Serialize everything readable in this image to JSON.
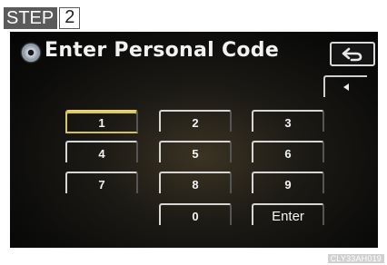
{
  "step": {
    "word": "STEP",
    "number": "2"
  },
  "screen": {
    "title": "Enter Personal Code",
    "back_icon": "return-arrow-icon",
    "prev_icon": "left-triangle-icon"
  },
  "keypad": {
    "k1": "1",
    "k2": "2",
    "k3": "3",
    "k4": "4",
    "k5": "5",
    "k6": "6",
    "k7": "7",
    "k8": "8",
    "k9": "9",
    "k0": "0",
    "enter": "Enter"
  },
  "image_code": "CLY33AH019"
}
